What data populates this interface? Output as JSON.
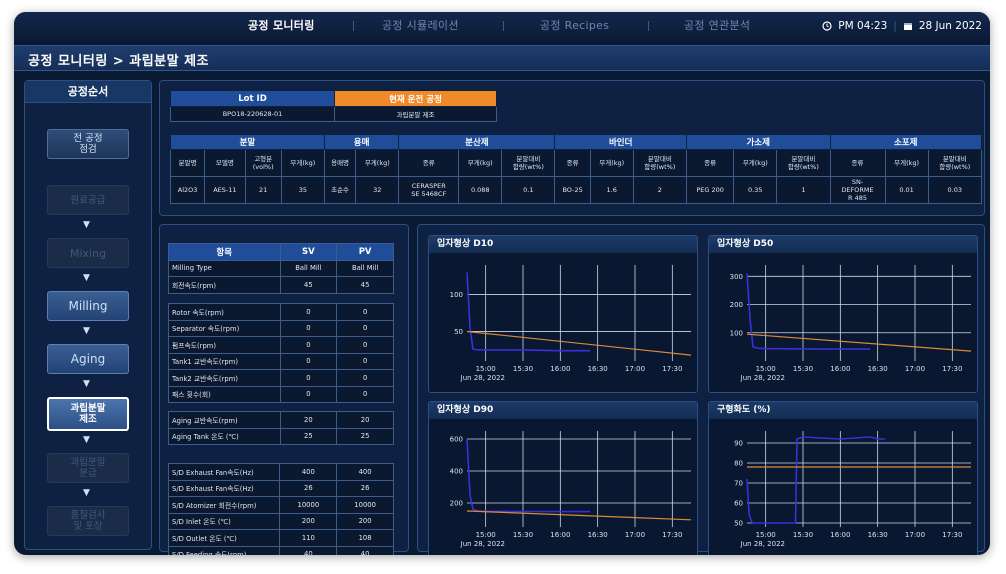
{
  "nav": {
    "tabs": [
      "공정 모니터링",
      "공정 시뮬레이션",
      "공정 Recipes",
      "공정 연관분석"
    ],
    "time": "PM 04:23",
    "date": "28 Jun 2022"
  },
  "page_title": "공정 모니터링 > 과립분말 제조",
  "steps": {
    "title": "공정순서",
    "items": [
      "전 공정\n점검",
      "원료공급",
      "Mixing",
      "Milling",
      "Aging",
      "과립분말\n제조",
      "과립분말\n분급",
      "품질검사\n및 포장"
    ]
  },
  "lot": {
    "lot_id_label": "Lot ID",
    "current_label": "현재 운전 공정",
    "lot_id": "BPO18-220628-01",
    "current": "과립분말 제조"
  },
  "materials": {
    "groups": [
      "분말",
      "용매",
      "분산제",
      "바인더",
      "가소제",
      "소포제"
    ],
    "columns": [
      "분말명",
      "모델명",
      "고형분\n(vol%)",
      "무게(kg)",
      "용매명",
      "무게(kg)",
      "종류",
      "무게(kg)",
      "분말대비\n함량(wt%)",
      "종류",
      "무게(kg)",
      "분말대비\n함량(wt%)",
      "종류",
      "무게(kg)",
      "분말대비\n함량(wt%)",
      "종류",
      "무게(kg)",
      "분말대비\n함량(wt%)"
    ],
    "values": [
      "Al2O3",
      "AES-11",
      "21",
      "35",
      "초순수",
      "32",
      "CERASPER\nSE 5468CF",
      "0.088",
      "0.1",
      "BO-25",
      "1.6",
      "2",
      "PEG 200",
      "0.35",
      "1",
      "SN-\nDEFORME\nR 485",
      "0.01",
      "0.03"
    ]
  },
  "params": {
    "headers": [
      "항목",
      "SV",
      "PV"
    ],
    "groups": [
      [
        [
          "Milling Type",
          "Ball Mill",
          "Ball Mill"
        ],
        [
          "회전속도(rpm)",
          "45",
          "45"
        ]
      ],
      [
        [
          "Rotor 속도(rpm)",
          "0",
          "0"
        ],
        [
          "Separator 속도(rpm)",
          "0",
          "0"
        ],
        [
          "펌프속도(rpm)",
          "0",
          "0"
        ],
        [
          "Tank1 교반속도(rpm)",
          "0",
          "0"
        ],
        [
          "Tank2 교반속도(rpm)",
          "0",
          "0"
        ],
        [
          "패스 횟수(회)",
          "0",
          "0"
        ]
      ],
      [
        [
          "Aging 교반속도(rpm)",
          "20",
          "20"
        ],
        [
          "Aging Tank 온도 (℃)",
          "25",
          "25"
        ]
      ],
      [
        [
          "S/D Exhaust Fan속도(Hz)",
          "400",
          "400"
        ],
        [
          "S/D Exhaust Fan속도(Hz)",
          "26",
          "26"
        ],
        [
          "S/D Atomizer 회전수(rpm)",
          "10000",
          "10000"
        ],
        [
          "S/D Inlet 온도 (℃)",
          "200",
          "200"
        ],
        [
          "S/D Outlet 온도 (℃)",
          "110",
          "108"
        ],
        [
          "S/D Feeding 속도(rpm)",
          "40",
          "40"
        ]
      ]
    ]
  },
  "chart_data": [
    {
      "type": "line",
      "title": "입자형상 D10",
      "x_ticks": [
        "15:00",
        "15:30",
        "16:00",
        "16:30",
        "17:00",
        "17:30"
      ],
      "date_label": "Jun 28, 2022",
      "y_ticks": [
        50,
        100
      ],
      "ylim": [
        10,
        140
      ],
      "series": [
        {
          "color": "#3a2fd8",
          "x": [
            14.75,
            14.79,
            14.83,
            14.9,
            15.0,
            15.5,
            16.0,
            16.4
          ],
          "y": [
            130,
            55,
            26,
            25,
            25,
            25,
            24,
            24
          ]
        },
        {
          "color": "#d98a3a",
          "x": [
            14.75,
            17.75
          ],
          "y": [
            50,
            18
          ]
        }
      ]
    },
    {
      "type": "line",
      "title": "입자형상 D50",
      "x_ticks": [
        "15:00",
        "15:30",
        "16:00",
        "16:30",
        "17:00",
        "17:30"
      ],
      "date_label": "Jun 28, 2022",
      "y_ticks": [
        100,
        200,
        300
      ],
      "ylim": [
        0,
        340
      ],
      "series": [
        {
          "color": "#3a2fd8",
          "x": [
            14.75,
            14.79,
            14.83,
            14.9,
            15.0,
            15.5,
            16.0,
            16.4
          ],
          "y": [
            310,
            150,
            50,
            45,
            44,
            43,
            42,
            42
          ]
        },
        {
          "color": "#d98a3a",
          "x": [
            14.75,
            17.75
          ],
          "y": [
            95,
            35
          ]
        }
      ]
    },
    {
      "type": "line",
      "title": "입자형상 D90",
      "x_ticks": [
        "15:00",
        "15:30",
        "16:00",
        "16:30",
        "17:00",
        "17:30"
      ],
      "date_label": "Jun 28, 2022",
      "y_ticks": [
        200,
        400,
        600
      ],
      "ylim": [
        50,
        650
      ],
      "series": [
        {
          "color": "#3a2fd8",
          "x": [
            14.75,
            14.79,
            14.83,
            14.9,
            15.0,
            15.5,
            16.0,
            16.4
          ],
          "y": [
            600,
            250,
            160,
            150,
            148,
            147,
            146,
            146
          ]
        },
        {
          "color": "#d98a3a",
          "x": [
            14.75,
            17.75
          ],
          "y": [
            150,
            95
          ]
        }
      ]
    },
    {
      "type": "line",
      "title": "구형화도 (%)",
      "x_ticks": [
        "15:00",
        "15:30",
        "16:00",
        "16:30",
        "17:00",
        "17:30"
      ],
      "date_label": "Jun 28, 2022",
      "y_ticks": [
        50,
        60,
        70,
        80,
        90
      ],
      "ylim": [
        48,
        96
      ],
      "series": [
        {
          "color": "#3a2fd8",
          "x": [
            14.75,
            14.78,
            14.82,
            15.4,
            15.42,
            15.5,
            16.0,
            16.4,
            16.5,
            16.6
          ],
          "y": [
            72,
            54,
            50,
            50,
            92,
            93,
            92,
            93,
            92,
            92
          ]
        },
        {
          "color": "#d98a3a",
          "x": [
            14.75,
            17.75
          ],
          "y": [
            78,
            78
          ]
        }
      ]
    }
  ]
}
